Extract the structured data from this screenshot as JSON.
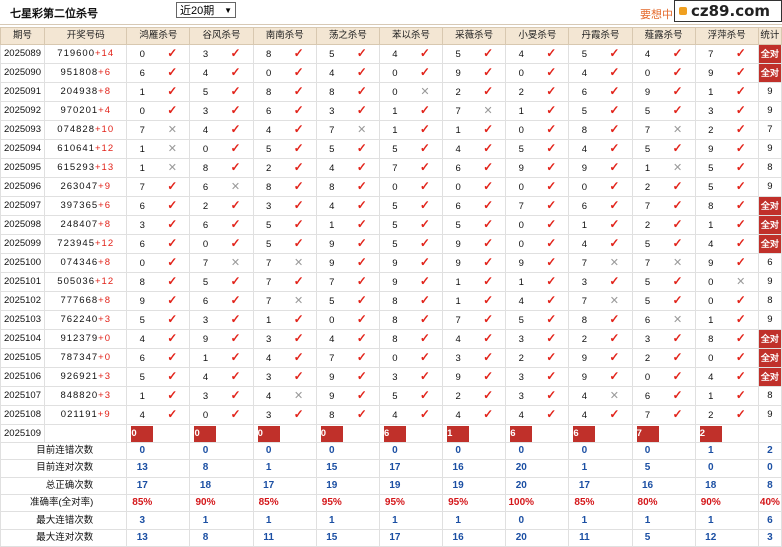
{
  "page_title": "七星彩第二位杀号",
  "period_select": "近20期",
  "promo_text": "要想中",
  "logo_text": "cz89.com",
  "columns": [
    "期号",
    "开奖号码",
    "鸿雁杀号",
    "谷风杀号",
    "南南杀号",
    "荡之杀号",
    "苯以杀号",
    "采薇杀号",
    "小旻杀号",
    "丹霞杀号",
    "薤露杀号",
    "浮萍杀号",
    "统计"
  ],
  "rows": [
    {
      "period": "2025089",
      "draw": "719600",
      "sum": "+14",
      "kills": [
        [
          "0",
          "ok"
        ],
        [
          "3",
          "ok"
        ],
        [
          "8",
          "ok"
        ],
        [
          "5",
          "ok"
        ],
        [
          "4",
          "ok"
        ],
        [
          "5",
          "ok"
        ],
        [
          "4",
          "ok"
        ],
        [
          "5",
          "ok"
        ],
        [
          "4",
          "ok"
        ],
        [
          "7",
          "ok"
        ]
      ],
      "stat": "全对"
    },
    {
      "period": "2025090",
      "draw": "951808",
      "sum": "+6",
      "kills": [
        [
          "6",
          "ok"
        ],
        [
          "4",
          "ok"
        ],
        [
          "0",
          "ok"
        ],
        [
          "4",
          "ok"
        ],
        [
          "0",
          "ok"
        ],
        [
          "9",
          "ok"
        ],
        [
          "0",
          "ok"
        ],
        [
          "4",
          "ok"
        ],
        [
          "0",
          "ok"
        ],
        [
          "9",
          "ok"
        ]
      ],
      "stat": "全对"
    },
    {
      "period": "2025091",
      "draw": "204938",
      "sum": "+8",
      "kills": [
        [
          "1",
          "ok"
        ],
        [
          "5",
          "ok"
        ],
        [
          "8",
          "ok"
        ],
        [
          "8",
          "ok"
        ],
        [
          "0",
          "no"
        ],
        [
          "2",
          "ok"
        ],
        [
          "2",
          "ok"
        ],
        [
          "6",
          "ok"
        ],
        [
          "9",
          "ok"
        ],
        [
          "1",
          "ok"
        ]
      ],
      "stat": "9"
    },
    {
      "period": "2025092",
      "draw": "970201",
      "sum": "+4",
      "kills": [
        [
          "0",
          "ok"
        ],
        [
          "3",
          "ok"
        ],
        [
          "6",
          "ok"
        ],
        [
          "3",
          "ok"
        ],
        [
          "1",
          "ok"
        ],
        [
          "7",
          "no"
        ],
        [
          "1",
          "ok"
        ],
        [
          "5",
          "ok"
        ],
        [
          "5",
          "ok"
        ],
        [
          "3",
          "ok"
        ]
      ],
      "stat": "9"
    },
    {
      "period": "2025093",
      "draw": "074828",
      "sum": "+10",
      "kills": [
        [
          "7",
          "no"
        ],
        [
          "4",
          "ok"
        ],
        [
          "4",
          "ok"
        ],
        [
          "7",
          "no"
        ],
        [
          "1",
          "ok"
        ],
        [
          "1",
          "ok"
        ],
        [
          "0",
          "ok"
        ],
        [
          "8",
          "ok"
        ],
        [
          "7",
          "no"
        ],
        [
          "2",
          "ok"
        ]
      ],
      "stat": "7"
    },
    {
      "period": "2025094",
      "draw": "610641",
      "sum": "+12",
      "kills": [
        [
          "1",
          "no"
        ],
        [
          "0",
          "ok"
        ],
        [
          "5",
          "ok"
        ],
        [
          "5",
          "ok"
        ],
        [
          "5",
          "ok"
        ],
        [
          "4",
          "ok"
        ],
        [
          "5",
          "ok"
        ],
        [
          "4",
          "ok"
        ],
        [
          "5",
          "ok"
        ],
        [
          "9",
          "ok"
        ]
      ],
      "stat": "9"
    },
    {
      "period": "2025095",
      "draw": "615293",
      "sum": "+13",
      "kills": [
        [
          "1",
          "no"
        ],
        [
          "8",
          "ok"
        ],
        [
          "2",
          "ok"
        ],
        [
          "4",
          "ok"
        ],
        [
          "7",
          "ok"
        ],
        [
          "6",
          "ok"
        ],
        [
          "9",
          "ok"
        ],
        [
          "9",
          "ok"
        ],
        [
          "1",
          "no"
        ],
        [
          "5",
          "ok"
        ]
      ],
      "stat": "8"
    },
    {
      "period": "2025096",
      "draw": "263047",
      "sum": "+9",
      "kills": [
        [
          "7",
          "ok"
        ],
        [
          "6",
          "no"
        ],
        [
          "8",
          "ok"
        ],
        [
          "8",
          "ok"
        ],
        [
          "0",
          "ok"
        ],
        [
          "0",
          "ok"
        ],
        [
          "0",
          "ok"
        ],
        [
          "0",
          "ok"
        ],
        [
          "2",
          "ok"
        ],
        [
          "5",
          "ok"
        ]
      ],
      "stat": "9"
    },
    {
      "period": "2025097",
      "draw": "397365",
      "sum": "+6",
      "kills": [
        [
          "6",
          "ok"
        ],
        [
          "2",
          "ok"
        ],
        [
          "3",
          "ok"
        ],
        [
          "4",
          "ok"
        ],
        [
          "5",
          "ok"
        ],
        [
          "6",
          "ok"
        ],
        [
          "7",
          "ok"
        ],
        [
          "6",
          "ok"
        ],
        [
          "7",
          "ok"
        ],
        [
          "8",
          "ok"
        ]
      ],
      "stat": "全对"
    },
    {
      "period": "2025098",
      "draw": "248407",
      "sum": "+8",
      "kills": [
        [
          "3",
          "ok"
        ],
        [
          "6",
          "ok"
        ],
        [
          "5",
          "ok"
        ],
        [
          "1",
          "ok"
        ],
        [
          "5",
          "ok"
        ],
        [
          "5",
          "ok"
        ],
        [
          "0",
          "ok"
        ],
        [
          "1",
          "ok"
        ],
        [
          "2",
          "ok"
        ],
        [
          "1",
          "ok"
        ]
      ],
      "stat": "全对"
    },
    {
      "period": "2025099",
      "draw": "723945",
      "sum": "+12",
      "kills": [
        [
          "6",
          "ok"
        ],
        [
          "0",
          "ok"
        ],
        [
          "5",
          "ok"
        ],
        [
          "9",
          "ok"
        ],
        [
          "5",
          "ok"
        ],
        [
          "9",
          "ok"
        ],
        [
          "0",
          "ok"
        ],
        [
          "4",
          "ok"
        ],
        [
          "5",
          "ok"
        ],
        [
          "4",
          "ok"
        ]
      ],
      "stat": "全对"
    },
    {
      "period": "2025100",
      "draw": "074346",
      "sum": "+8",
      "kills": [
        [
          "0",
          "ok"
        ],
        [
          "7",
          "no"
        ],
        [
          "7",
          "no"
        ],
        [
          "9",
          "ok"
        ],
        [
          "9",
          "ok"
        ],
        [
          "9",
          "ok"
        ],
        [
          "9",
          "ok"
        ],
        [
          "7",
          "no"
        ],
        [
          "7",
          "no"
        ],
        [
          "9",
          "ok"
        ]
      ],
      "stat": "6"
    },
    {
      "period": "2025101",
      "draw": "505036",
      "sum": "+12",
      "kills": [
        [
          "8",
          "ok"
        ],
        [
          "5",
          "ok"
        ],
        [
          "7",
          "ok"
        ],
        [
          "7",
          "ok"
        ],
        [
          "9",
          "ok"
        ],
        [
          "1",
          "ok"
        ],
        [
          "1",
          "ok"
        ],
        [
          "3",
          "ok"
        ],
        [
          "5",
          "ok"
        ],
        [
          "0",
          "no"
        ]
      ],
      "stat": "9"
    },
    {
      "period": "2025102",
      "draw": "777668",
      "sum": "+8",
      "kills": [
        [
          "9",
          "ok"
        ],
        [
          "6",
          "ok"
        ],
        [
          "7",
          "no"
        ],
        [
          "5",
          "ok"
        ],
        [
          "8",
          "ok"
        ],
        [
          "1",
          "ok"
        ],
        [
          "4",
          "ok"
        ],
        [
          "7",
          "no"
        ],
        [
          "5",
          "ok"
        ],
        [
          "0",
          "ok"
        ]
      ],
      "stat": "8"
    },
    {
      "period": "2025103",
      "draw": "762240",
      "sum": "+3",
      "kills": [
        [
          "5",
          "ok"
        ],
        [
          "3",
          "ok"
        ],
        [
          "1",
          "ok"
        ],
        [
          "0",
          "ok"
        ],
        [
          "8",
          "ok"
        ],
        [
          "7",
          "ok"
        ],
        [
          "5",
          "ok"
        ],
        [
          "8",
          "ok"
        ],
        [
          "6",
          "no"
        ],
        [
          "1",
          "ok"
        ]
      ],
      "stat": "9"
    },
    {
      "period": "2025104",
      "draw": "912379",
      "sum": "+0",
      "kills": [
        [
          "4",
          "ok"
        ],
        [
          "9",
          "ok"
        ],
        [
          "3",
          "ok"
        ],
        [
          "4",
          "ok"
        ],
        [
          "8",
          "ok"
        ],
        [
          "4",
          "ok"
        ],
        [
          "3",
          "ok"
        ],
        [
          "2",
          "ok"
        ],
        [
          "3",
          "ok"
        ],
        [
          "8",
          "ok"
        ]
      ],
      "stat": "全对"
    },
    {
      "period": "2025105",
      "draw": "787347",
      "sum": "+0",
      "kills": [
        [
          "6",
          "ok"
        ],
        [
          "1",
          "ok"
        ],
        [
          "4",
          "ok"
        ],
        [
          "7",
          "ok"
        ],
        [
          "0",
          "ok"
        ],
        [
          "3",
          "ok"
        ],
        [
          "2",
          "ok"
        ],
        [
          "9",
          "ok"
        ],
        [
          "2",
          "ok"
        ],
        [
          "0",
          "ok"
        ]
      ],
      "stat": "全对"
    },
    {
      "period": "2025106",
      "draw": "926921",
      "sum": "+3",
      "kills": [
        [
          "5",
          "ok"
        ],
        [
          "4",
          "ok"
        ],
        [
          "3",
          "ok"
        ],
        [
          "9",
          "ok"
        ],
        [
          "3",
          "ok"
        ],
        [
          "9",
          "ok"
        ],
        [
          "3",
          "ok"
        ],
        [
          "9",
          "ok"
        ],
        [
          "0",
          "ok"
        ],
        [
          "4",
          "ok"
        ]
      ],
      "stat": "全对"
    },
    {
      "period": "2025107",
      "draw": "848820",
      "sum": "+3",
      "kills": [
        [
          "1",
          "ok"
        ],
        [
          "3",
          "ok"
        ],
        [
          "4",
          "no"
        ],
        [
          "9",
          "ok"
        ],
        [
          "5",
          "ok"
        ],
        [
          "2",
          "ok"
        ],
        [
          "3",
          "ok"
        ],
        [
          "4",
          "no"
        ],
        [
          "6",
          "ok"
        ],
        [
          "1",
          "ok"
        ]
      ],
      "stat": "8"
    },
    {
      "period": "2025108",
      "draw": "021191",
      "sum": "+9",
      "kills": [
        [
          "4",
          "ok"
        ],
        [
          "0",
          "ok"
        ],
        [
          "3",
          "ok"
        ],
        [
          "8",
          "ok"
        ],
        [
          "4",
          "ok"
        ],
        [
          "4",
          "ok"
        ],
        [
          "4",
          "ok"
        ],
        [
          "4",
          "ok"
        ],
        [
          "7",
          "ok"
        ],
        [
          "2",
          "ok"
        ]
      ],
      "stat": "9"
    }
  ],
  "current": {
    "period": "2025109",
    "label": "当前期杀号",
    "values": [
      "0",
      "0",
      "0",
      "0",
      "6",
      "1",
      "6",
      "6",
      "7",
      "2"
    ]
  },
  "summary": [
    {
      "label": "目前连错次数",
      "values": [
        "0",
        "0",
        "0",
        "0",
        "0",
        "0",
        "0",
        "0",
        "0",
        "1"
      ],
      "stat": "2",
      "red": false
    },
    {
      "label": "目前连对次数",
      "values": [
        "13",
        "8",
        "1",
        "15",
        "17",
        "16",
        "20",
        "1",
        "5",
        "0"
      ],
      "stat": "0",
      "red": false
    },
    {
      "label": "总正确次数",
      "values": [
        "17",
        "18",
        "17",
        "19",
        "19",
        "19",
        "20",
        "17",
        "16",
        "18"
      ],
      "stat": "8",
      "red": false
    },
    {
      "label": "准确率(全对率)",
      "values": [
        "85%",
        "90%",
        "85%",
        "95%",
        "95%",
        "95%",
        "100%",
        "85%",
        "80%",
        "90%"
      ],
      "stat": "40%",
      "red": true
    },
    {
      "label": "最大连错次数",
      "values": [
        "3",
        "1",
        "1",
        "1",
        "1",
        "1",
        "0",
        "1",
        "1",
        "1"
      ],
      "stat": "6",
      "red": false
    },
    {
      "label": "最大连对次数",
      "values": [
        "13",
        "8",
        "11",
        "15",
        "17",
        "16",
        "20",
        "11",
        "5",
        "12"
      ],
      "stat": "3",
      "red": false
    }
  ]
}
